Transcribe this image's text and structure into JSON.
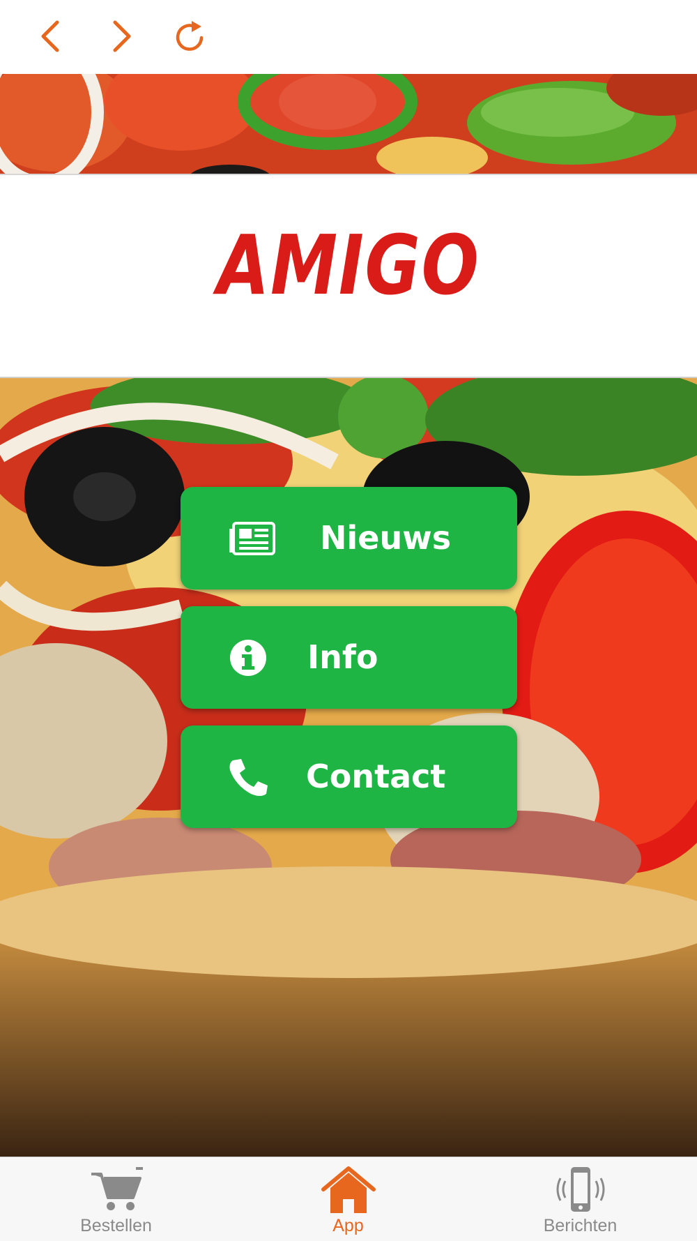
{
  "colors": {
    "accent": "#e8671f",
    "button_green": "#1fb544",
    "logo_red": "#d91c17",
    "tab_inactive": "#8a8a8a",
    "tab_active": "#e8671f"
  },
  "nav": {
    "back_icon": "chevron-left-icon",
    "forward_icon": "chevron-right-icon",
    "reload_icon": "reload-icon"
  },
  "logo": {
    "text": "AMIGO"
  },
  "actions": [
    {
      "label": "Nieuws",
      "icon": "newspaper-icon"
    },
    {
      "label": "Info",
      "icon": "info-circle-icon"
    },
    {
      "label": "Contact",
      "icon": "phone-icon"
    }
  ],
  "tabbar": {
    "tabs": [
      {
        "label": "Bestellen",
        "icon": "cart-icon",
        "active": false
      },
      {
        "label": "App",
        "icon": "home-icon",
        "active": true
      },
      {
        "label": "Berichten",
        "icon": "phone-vibrate-icon",
        "active": false
      }
    ]
  }
}
